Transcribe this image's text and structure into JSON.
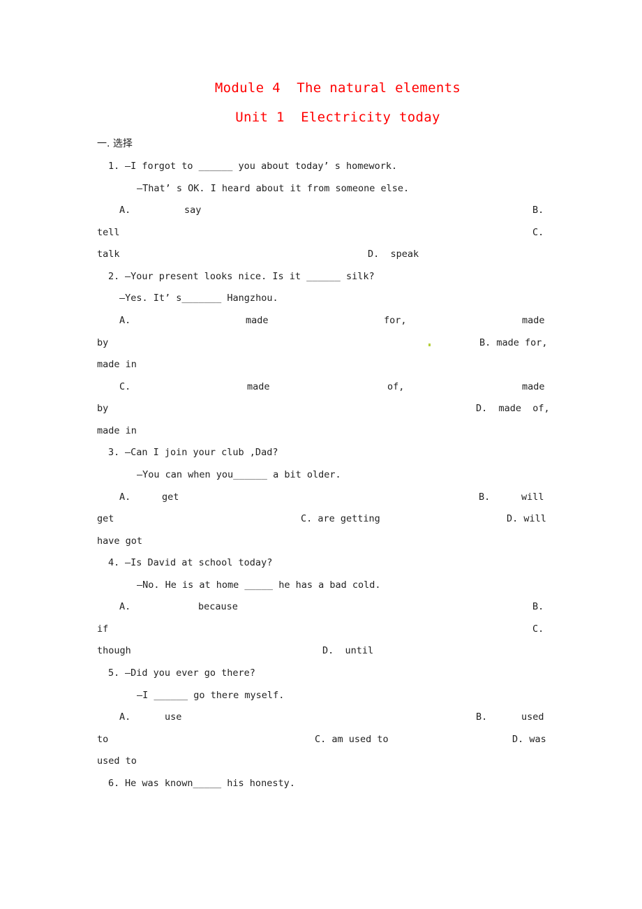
{
  "document": {
    "title": "Module 4  The natural elements",
    "subtitle": "Unit 1  Electricity today",
    "section_heading": "一. 选择",
    "questions": [
      {
        "number": "1.",
        "prompt": "—I forgot to ______ you about today’ s homework.",
        "reply": "—That’ s OK. I heard about it from someone else.",
        "options": {
          "A": "say",
          "B": "tell",
          "C": "talk",
          "D": "speak"
        }
      },
      {
        "number": "2.",
        "prompt": "—Your present looks nice. Is it ______ silk?",
        "reply": "—Yes. It’ s_______ Hangzhou.",
        "options": {
          "A": "made for, made by",
          "B": "made for, made in",
          "C": "made of, made by",
          "D": "made of, made in"
        }
      },
      {
        "number": "3.",
        "prompt": "—Can I join your club ,Dad?",
        "reply": "—You can when you______ a bit older.",
        "options": {
          "A": "get",
          "B": "will get",
          "C": "are getting",
          "D": "will have got"
        }
      },
      {
        "number": "4.",
        "prompt": "—Is David at school today?",
        "reply": "—No. He is at home _____ he has a bad cold.",
        "options": {
          "A": "because",
          "B": "if",
          "C": "though",
          "D": "until"
        }
      },
      {
        "number": "5.",
        "prompt": "—Did you ever go there?",
        "reply": "—I ______ go there myself.",
        "options": {
          "A": "use",
          "B": "used to",
          "C": "am used to",
          "D": "was used to"
        }
      },
      {
        "number": "6.",
        "prompt": "He was known_____ his honesty."
      }
    ],
    "lines": {
      "q1_a": "A.",
      "q1_a_text": "say",
      "q1_b": "B.",
      "q1_b_text": "tell",
      "q1_c": "C.",
      "q1_c_text": "talk",
      "q1_d": "D.  speak",
      "q2_a": "A.",
      "q2_a1": "made",
      "q2_a2": "for,",
      "q2_a3": "made",
      "q2_a4": "by",
      "q2_b": "B. made for,",
      "q2_b2": "made in",
      "q2_c": "C.",
      "q2_c1": "made",
      "q2_c2": "of,",
      "q2_c3": "made",
      "q2_c4": "by",
      "q2_d": "D.  made  of,",
      "q2_d2": "made in",
      "q3_a": "A.",
      "q3_a_text": "get",
      "q3_b": "B.",
      "q3_b_text": "will",
      "q3_b2": "get",
      "q3_c": "C. are getting",
      "q3_d": "D. will",
      "q3_d2": "have got",
      "q4_a": "A.",
      "q4_a_text": "because",
      "q4_b": "B.",
      "q4_b_text": "if",
      "q4_c": "C.",
      "q4_c_text": "though",
      "q4_d": "D.  until",
      "q5_a": "A.",
      "q5_a_text": "use",
      "q5_b": "B.",
      "q5_b_text": "used",
      "q5_b2": "to",
      "q5_c": "C. am used to",
      "q5_d": "D. was",
      "q5_d2": "used to"
    }
  }
}
